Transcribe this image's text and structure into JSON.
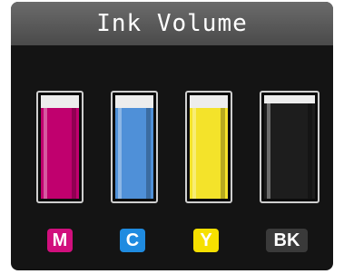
{
  "header": {
    "title": "Ink Volume"
  },
  "cartridges": [
    {
      "label": "M",
      "color": "#c0006e",
      "badge_bg": "#d10f7d",
      "badge_text": "#ffffff",
      "level_percent": 88
    },
    {
      "label": "C",
      "color": "#4f90d8",
      "badge_bg": "#1f8be0",
      "badge_text": "#ffffff",
      "level_percent": 88
    },
    {
      "label": "Y",
      "color": "#f4e32a",
      "badge_bg": "#f6e000",
      "badge_text": "#ffffff",
      "level_percent": 88
    },
    {
      "label": "BK",
      "color": "#1d1d1d",
      "badge_bg": "#3a3a3a",
      "badge_text": "#ffffff",
      "level_percent": 92
    }
  ]
}
